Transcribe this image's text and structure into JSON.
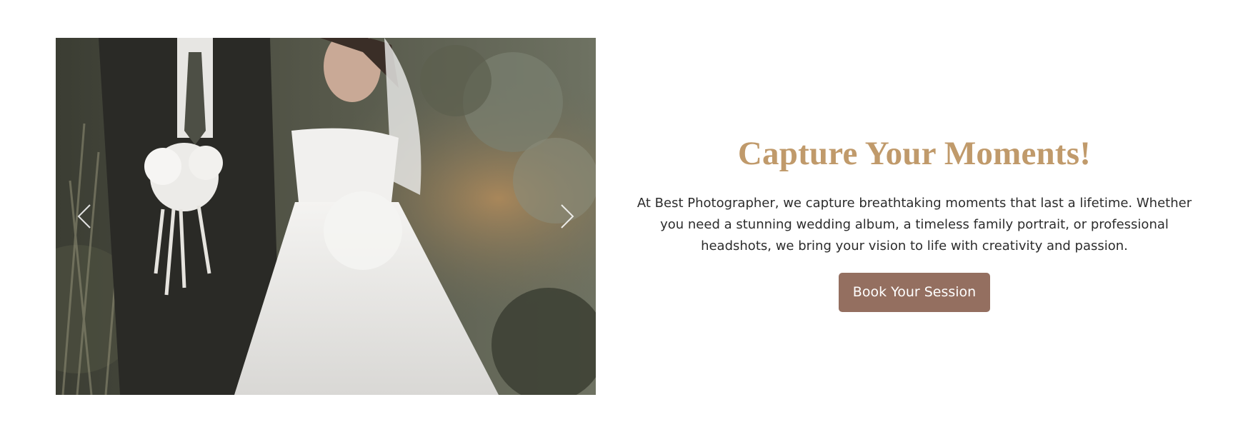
{
  "hero": {
    "title": "Capture Your Moments!",
    "description": "At Best Photographer, we capture breathtaking moments that last a lifetime. Whether you need a stunning wedding album, a timeless family portrait, or professional headshots, we bring your vision to life with creativity and passion.",
    "cta_label": "Book Your Session",
    "title_color": "#c09a6b",
    "cta_color": "#946f60"
  },
  "carousel": {
    "image_subject": "wedding-couple-photo",
    "prev_icon": "chevron-left-icon",
    "next_icon": "chevron-right-icon"
  }
}
